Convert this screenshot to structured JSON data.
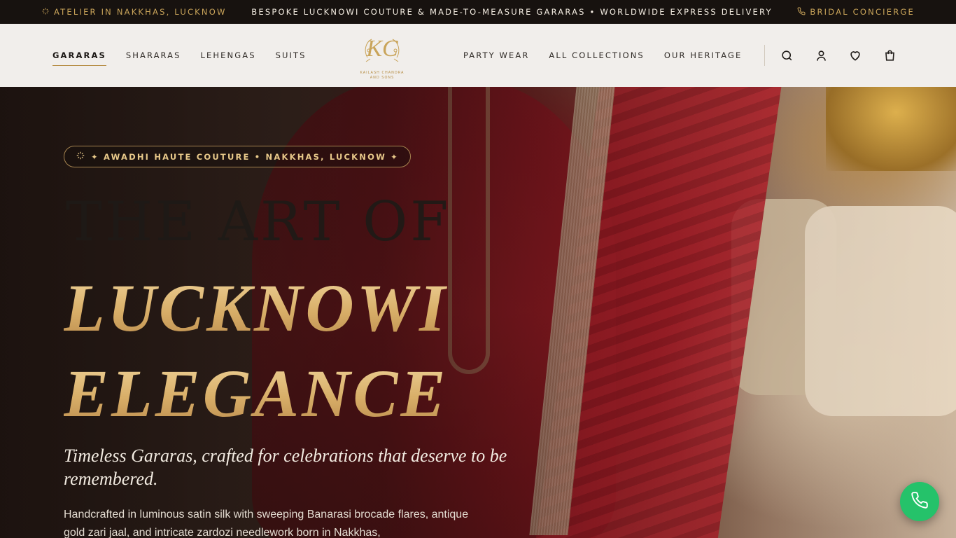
{
  "announcement": {
    "left": "ATELIER IN NAKKHAS, LUCKNOW",
    "center": "BESPOKE LUCKNOWI COUTURE & MADE-TO-MEASURE GARARAS • WORLDWIDE EXPRESS DELIVERY",
    "right": "BRIDAL CONCIERGE"
  },
  "nav": {
    "left": [
      "GARARAS",
      "SHARARAS",
      "LEHENGAS",
      "SUITS"
    ],
    "right": [
      "PARTY WEAR",
      "ALL COLLECTIONS",
      "OUR HERITAGE"
    ],
    "active_index": 0
  },
  "logo": {
    "monogram": "KC",
    "line1": "KAILASH CHANDRA",
    "line2": "AND SONS"
  },
  "hero": {
    "badge": "✦ AWADHI HAUTE COUTURE • NAKKHAS, LUCKNOW ✦",
    "title_line1": "THE ART OF",
    "title_line2": "LUCKNOWI",
    "title_line3": "ELEGANCE",
    "tagline": "Timeless Gararas, crafted for celebrations that deserve to be remembered.",
    "description": "Handcrafted in luminous satin silk with sweeping Banarasi brocade flares, antique gold zari jaal, and intricate zardozi needlework born in Nakkhas,"
  },
  "icons": [
    "sparkle-icon",
    "phone-icon",
    "search-icon",
    "user-icon",
    "heart-icon",
    "bag-icon"
  ],
  "colors": {
    "gold": "#c9a45a",
    "topbar_bg": "#17120f",
    "header_bg": "#faf8f5",
    "fab_green": "#25c26a"
  }
}
